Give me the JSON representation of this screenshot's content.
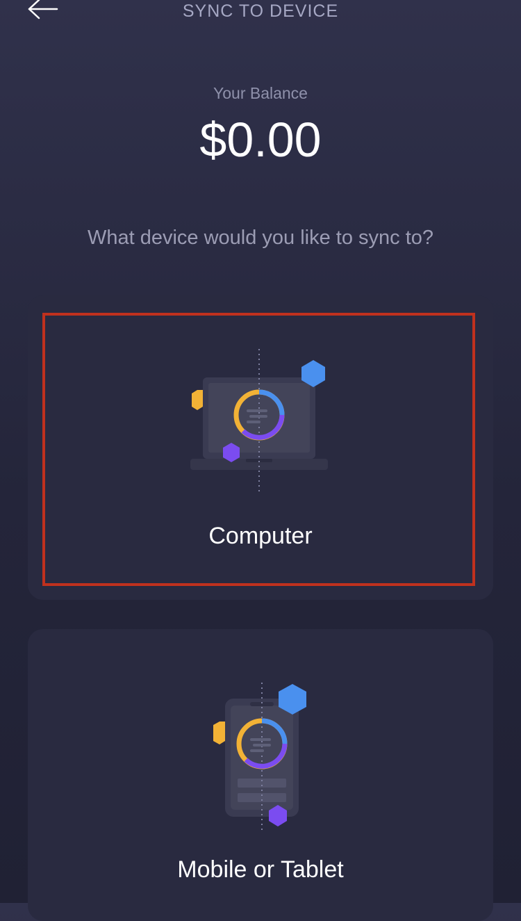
{
  "header": {
    "title": "SYNC TO DEVICE",
    "back_icon": "arrow-left-icon"
  },
  "balance": {
    "label": "Your Balance",
    "value": "$0.00"
  },
  "question": "What device would you like to sync to?",
  "options": [
    {
      "label": "Computer",
      "icon": "laptop-sync-icon",
      "selected": true
    },
    {
      "label": "Mobile or Tablet",
      "icon": "phone-sync-icon",
      "selected": false
    }
  ],
  "colors": {
    "background": "#2a2b43",
    "card": "#292a40",
    "highlight": "#c0311e",
    "accent_orange": "#f2b236",
    "accent_blue": "#4a90ee",
    "accent_purple": "#7b4cf0"
  }
}
